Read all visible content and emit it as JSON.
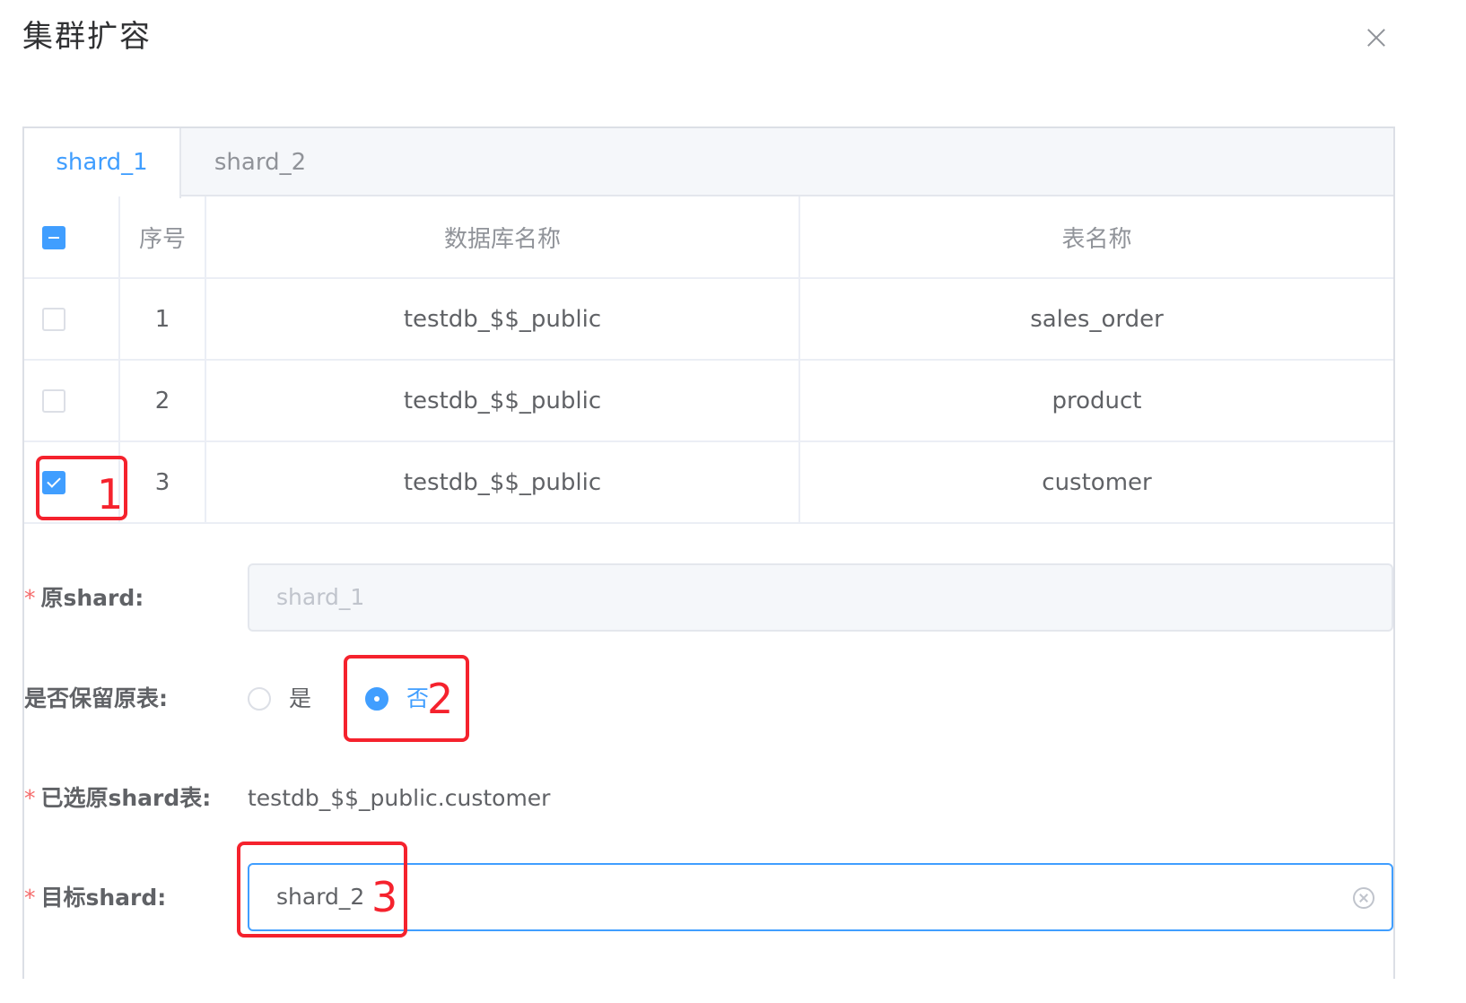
{
  "dialog": {
    "title": "集群扩容",
    "close_icon": "close-icon"
  },
  "tabs": [
    {
      "label": "shard_1",
      "active": true
    },
    {
      "label": "shard_2",
      "active": false
    }
  ],
  "table": {
    "columns": [
      "序号",
      "数据库名称",
      "表名称"
    ],
    "select_all_state": "indeterminate",
    "rows": [
      {
        "checked": false,
        "index": "1",
        "database": "testdb_$$_public",
        "table": "sales_order"
      },
      {
        "checked": false,
        "index": "2",
        "database": "testdb_$$_public",
        "table": "product"
      },
      {
        "checked": true,
        "index": "3",
        "database": "testdb_$$_public",
        "table": "customer"
      }
    ]
  },
  "form": {
    "required_mark": "*",
    "source_shard": {
      "label": "原shard:",
      "value": "shard_1"
    },
    "keep_original": {
      "label": "是否保留原表:",
      "options": [
        {
          "label": "是",
          "selected": false
        },
        {
          "label": "否",
          "selected": true
        }
      ]
    },
    "selected_tables": {
      "label": "已选原shard表:",
      "value": "testdb_$$_public.customer"
    },
    "target_shard": {
      "label": "目标shard:",
      "value": "shard_2"
    }
  },
  "annotations": [
    "1",
    "2",
    "3"
  ],
  "colors": {
    "primary": "#409eff",
    "annotation": "#f5222d",
    "required": "#f56c6c"
  }
}
